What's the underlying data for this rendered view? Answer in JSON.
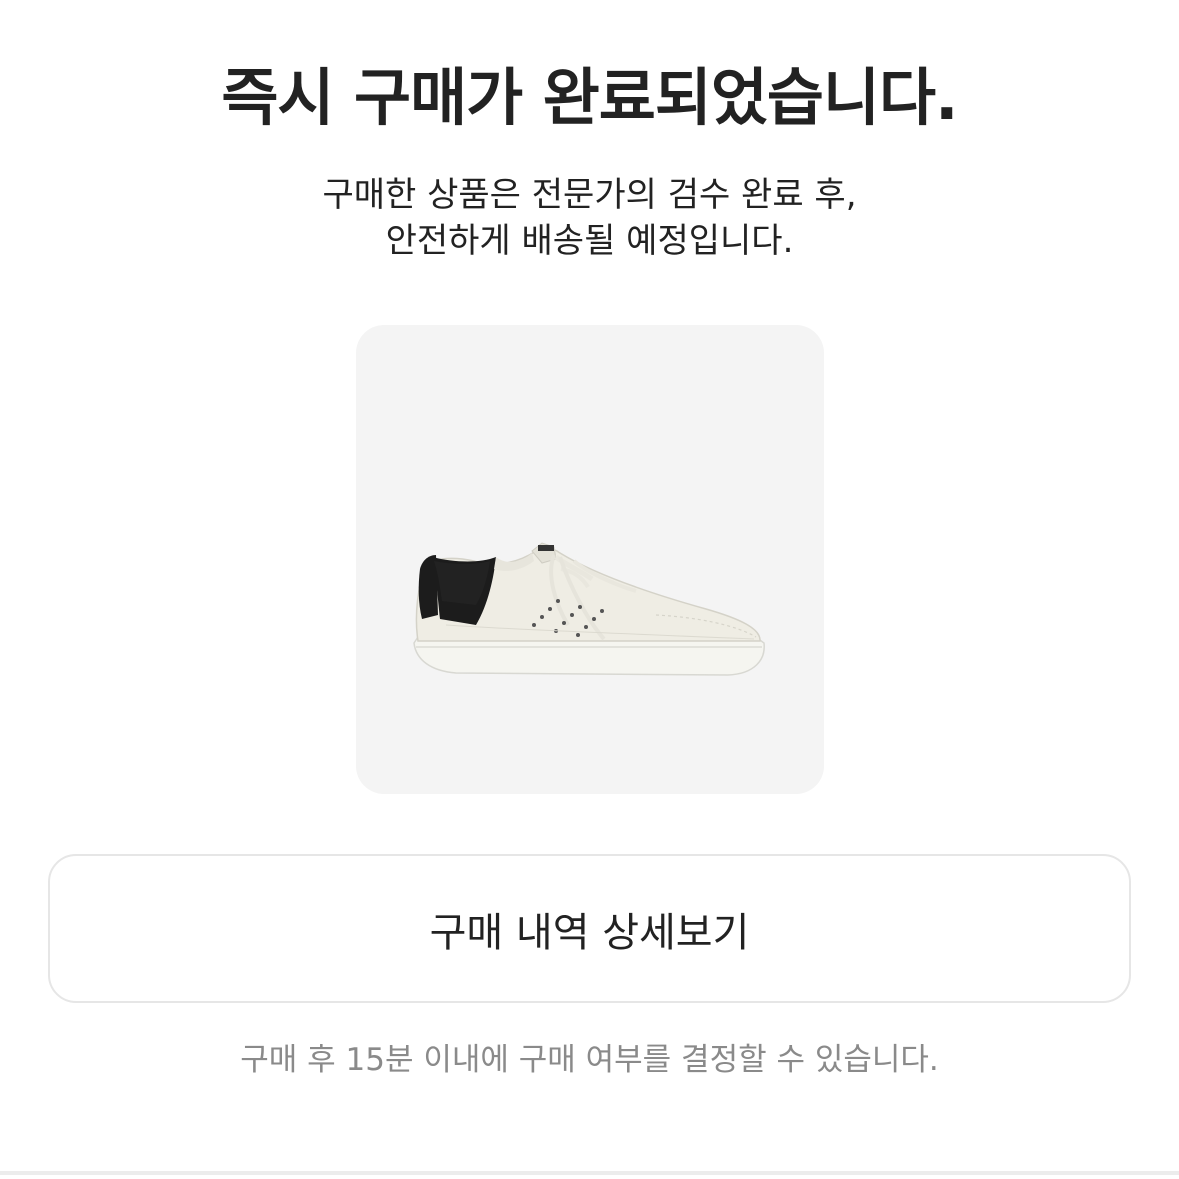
{
  "header": {
    "title": "즉시 구매가 완료되었습니다."
  },
  "message": {
    "line1": "구매한 상품은 전문가의 검수 완료 후,",
    "line2": "안전하게 배송될 예정입니다."
  },
  "product": {
    "image_icon": "sneaker-image",
    "background_color": "#f4f4f4"
  },
  "actions": {
    "detail_button_label": "구매 내역 상세보기"
  },
  "footer": {
    "notice": "구매 후 15분 이내에 구매 여부를 결정할 수 있습니다."
  },
  "colors": {
    "text_primary": "#222222",
    "text_secondary": "#8a8a8a",
    "border": "#e6e6e6"
  }
}
